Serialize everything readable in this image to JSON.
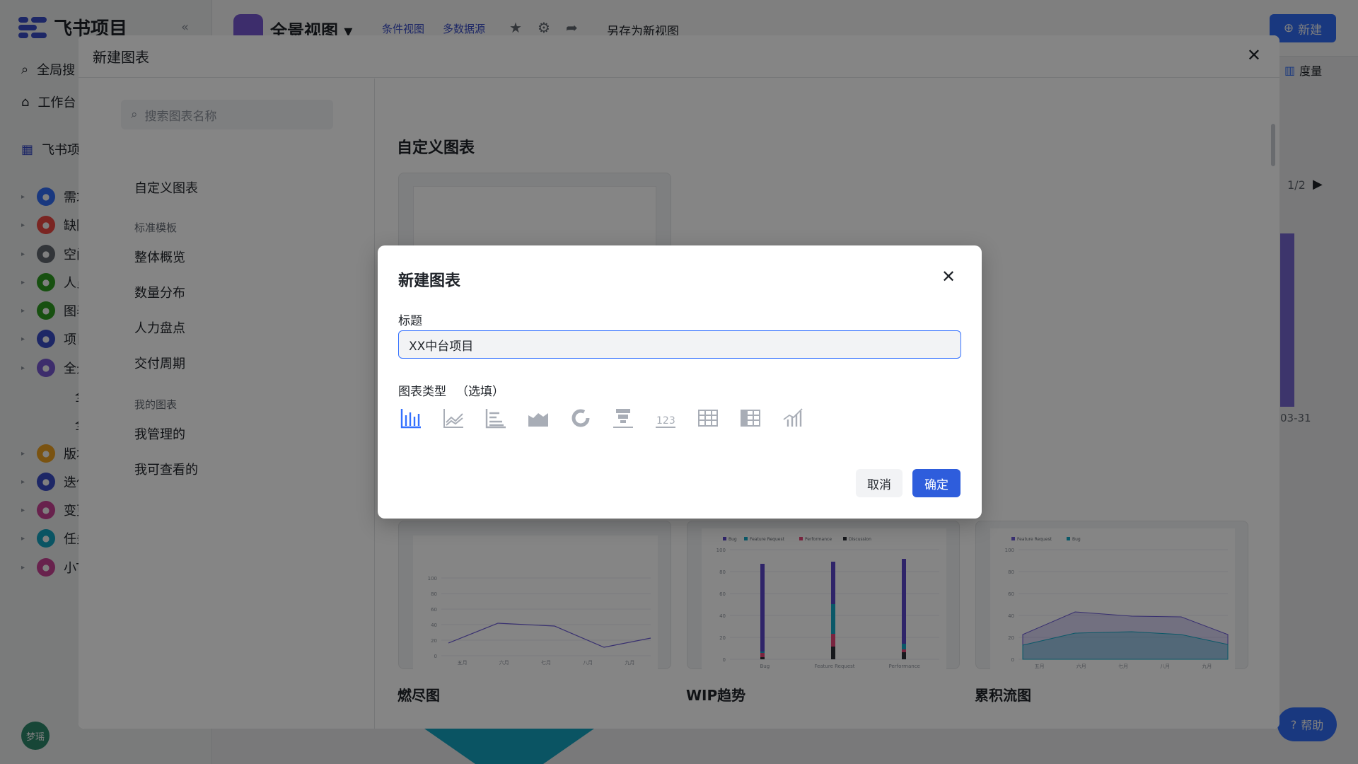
{
  "app": {
    "logo_text": "飞书项目",
    "search_label": "全局搜",
    "workspace_label": "工作台",
    "project_label": "飞书项",
    "avatar_text": "梦瑶",
    "help_label": "帮助"
  },
  "sidebar_tree": [
    {
      "label": "需求",
      "color": "#3370ff"
    },
    {
      "label": "缺陷",
      "color": "#f54a45"
    },
    {
      "label": "空间",
      "color": "#646a73"
    },
    {
      "label": "人员",
      "color": "#2ea121"
    },
    {
      "label": "图表",
      "color": "#2ea121"
    },
    {
      "label": "项目",
      "color": "#3b4fcc"
    },
    {
      "label": "全景",
      "color": "#7b5ad8"
    },
    {
      "label": "全景",
      "color": ""
    },
    {
      "label": "全部",
      "color": ""
    },
    {
      "label": "版本",
      "color": "#f5a623"
    },
    {
      "label": "迭代",
      "color": "#3b4fcc"
    },
    {
      "label": "变更",
      "color": "#d1449a"
    },
    {
      "label": "任务",
      "color": "#14a9c7"
    },
    {
      "label": "小T",
      "color": "#d1449a"
    }
  ],
  "topbar": {
    "view_title": "全景视图",
    "tag_condition": "条件视图",
    "tag_multi": "多数据源",
    "save_as": "另存为新视图",
    "new_button": "新建",
    "metric_label": "度量",
    "pager": "1/2",
    "date_label": "03-31"
  },
  "modal": {
    "title": "新建图表",
    "search_placeholder": "搜索图表名称",
    "nav_custom": "自定义图表",
    "group_standard": "标准模板",
    "nav_overview": "整体概览",
    "nav_distribution": "数量分布",
    "nav_manpower": "人力盘点",
    "nav_delivery": "交付周期",
    "group_mine": "我的图表",
    "nav_managed": "我管理的",
    "nav_viewable": "我可查看的",
    "section_title": "自定义图表",
    "card_burndown": "燃尽图",
    "card_wip": "WIP趋势",
    "card_cfd": "累积流图"
  },
  "dialog": {
    "title": "新建图表",
    "field_title_label": "标题",
    "field_title_value": "XX中台项目",
    "chart_type_label": "图表类型",
    "chart_type_hint": "（选填）",
    "chart_types": [
      "bar-chart-icon",
      "line-chart-icon",
      "horizontal-bar-icon",
      "area-chart-icon",
      "donut-chart-icon",
      "funnel-chart-icon",
      "number-card-icon",
      "table-icon",
      "pivot-table-icon",
      "combo-chart-icon"
    ],
    "selected_type": "bar-chart-icon",
    "cancel": "取消",
    "confirm": "确定"
  },
  "burndown_chart": {
    "y_ticks": [
      "100",
      "80",
      "60",
      "40",
      "20",
      "0"
    ],
    "x_ticks": [
      "五月",
      "六月",
      "七月",
      "八月",
      "九月"
    ]
  },
  "wip_chart": {
    "legend": [
      "Bug",
      "Feature Request",
      "Performance",
      "Discussion"
    ],
    "y_ticks": [
      "100",
      "80",
      "60",
      "40",
      "20",
      "0"
    ],
    "x_ticks": [
      "Bug",
      "Feature Request",
      "Performance"
    ]
  },
  "cfd_chart": {
    "legend": [
      "Feature Request",
      "Bug"
    ],
    "y_ticks": [
      "100",
      "80",
      "60",
      "40",
      "20",
      "0"
    ],
    "x_ticks": [
      "五月",
      "六月",
      "七月",
      "八月",
      "九月"
    ]
  },
  "colors": {
    "accent": "#3370ff",
    "confirm": "#2e5ddc"
  }
}
